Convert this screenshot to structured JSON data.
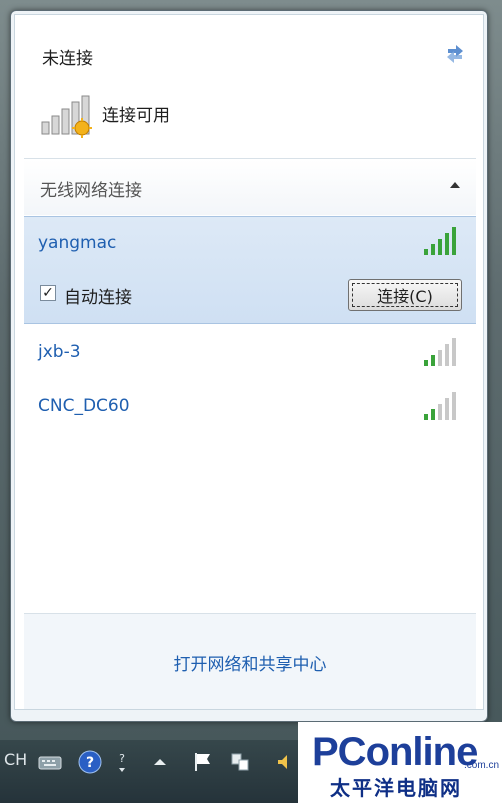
{
  "flyout": {
    "status_title": "未连接",
    "connection_available": "连接可用",
    "section_label": "无线网络连接",
    "networks": [
      {
        "name": "yangmac",
        "selected": true,
        "auto_connect": true,
        "auto_connect_label": "自动连接",
        "connect_button": "连接(C)",
        "signal_bars": 5
      },
      {
        "name": "jxb-3",
        "selected": false,
        "signal_bars": 2
      },
      {
        "name": "CNC_DC60",
        "selected": false,
        "signal_bars": 2
      }
    ],
    "footer_link": "打开网络和共享中心"
  },
  "taskbar": {
    "left_text": "CH"
  },
  "watermark": {
    "brand": "PConline",
    "domain": ".com.cn",
    "tagline": "太平洋电脑网"
  },
  "colors": {
    "link_blue": "#1f5fb0",
    "signal_green": "#3aa33a",
    "selection_blue": "#cfe0f3"
  },
  "icons": [
    "refresh-icon",
    "signal-strength-icon",
    "chevron-up-icon",
    "checkbox-icon",
    "language-icon",
    "help-icon",
    "flag-icon",
    "network-icon",
    "speaker-icon"
  ]
}
